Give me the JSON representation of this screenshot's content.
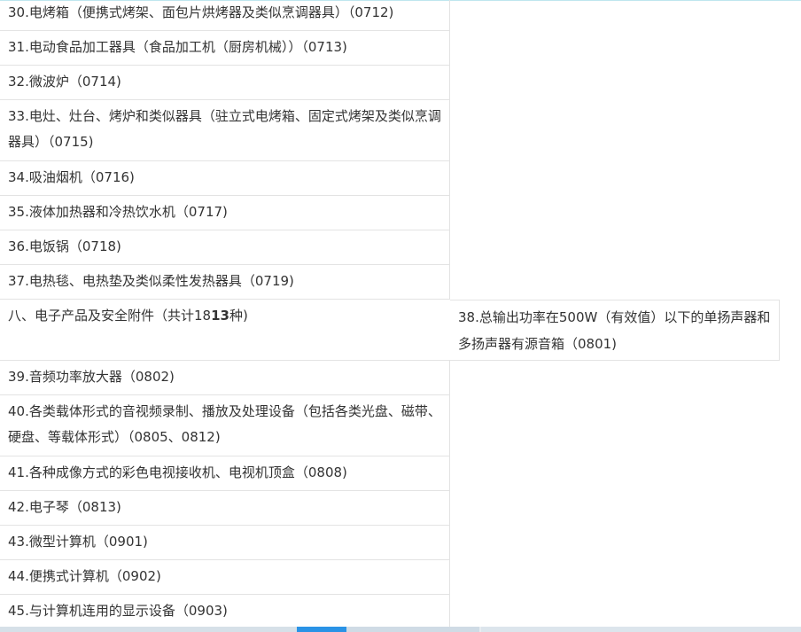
{
  "rows": [
    {
      "text": "30.电烤箱（便携式烤架、面包片烘烤器及类似烹调器具）（0712)"
    },
    {
      "text": "31.电动食品加工器具（食品加工机（厨房机械））（0713)"
    },
    {
      "text": "32.微波炉（0714)"
    },
    {
      "text": "33.电灶、灶台、烤炉和类似器具（驻立式电烤箱、固定式烤架及类似烹调器具）（0715)"
    },
    {
      "text": "34.吸油烟机（0716)"
    },
    {
      "text": "35.液体加热器和冷热饮水机（0717)"
    },
    {
      "text": "36.电饭锅（0718)"
    },
    {
      "text": "37.电热毯、电热垫及类似柔性发热器具（0719)"
    },
    {
      "text": "39.音频功率放大器（0802)"
    },
    {
      "text": "40.各类载体形式的音视频录制、播放及处理设备（包括各类光盘、磁带、硬盘、等载体形式）（0805、0812)"
    },
    {
      "text": "41.各种成像方式的彩色电视接收机、电视机顶盒（0808)"
    },
    {
      "text": "42.电子琴（0813)"
    },
    {
      "text": "43.微型计算机（0901)"
    },
    {
      "text": "44.便携式计算机（0902)"
    },
    {
      "text": "45.与计算机连用的显示设备（0903)"
    }
  ],
  "category": {
    "prefix": "八、电子产品及安全附件（共计18",
    "bold": "13",
    "suffix": "种)"
  },
  "side_item": {
    "text": "38.总输出功率在500W（有效值）以下的单扬声器和多扬声器有源音箱（0801)"
  },
  "colors": {
    "border": "#e3e3e3",
    "text": "#333333",
    "scroll_track": "#e8edf1",
    "scroll_thumb": "#2a93e6"
  }
}
